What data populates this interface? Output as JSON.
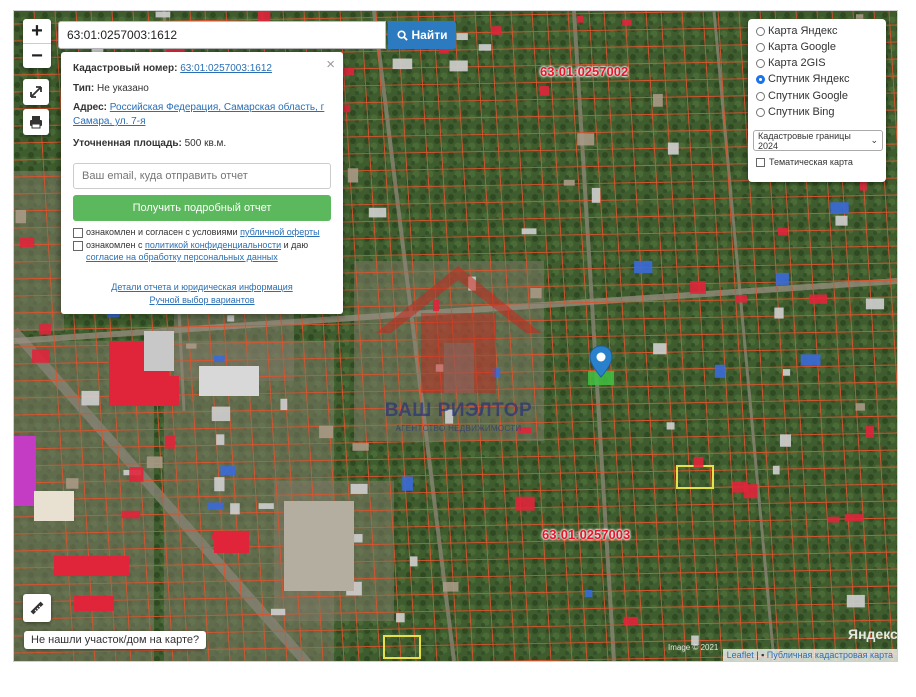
{
  "search": {
    "value": "63:01:0257003:1612",
    "button_label": "Найти"
  },
  "zoom": {
    "plus": "+",
    "minus": "−"
  },
  "popup": {
    "cadnum_label": "Кадастровый номер:",
    "cadnum_value": "63:01:0257003:1612",
    "type_label": "Тип:",
    "type_value": "Не указано",
    "address_label": "Адрес:",
    "address_value": "Российская Федерация, Самарская область, г Самара, ул. 7-я",
    "area_label": "Уточненная площадь:",
    "area_value": "500 кв.м.",
    "email_placeholder": "Ваш email, куда отправить отчет",
    "submit_label": "Получить подробный отчет",
    "consent1_prefix": "ознакомлен и согласен с условиями",
    "consent1_link": "публичной оферты",
    "consent2_prefix": "ознакомлен с",
    "consent2_link": "политикой конфиденциальности",
    "consent2_mid": "и даю",
    "consent2_link2": "согласие на обработку персональных данных",
    "details_link": "Детали отчета и юридическая информация",
    "manual_link": "Ручной выбор вариантов"
  },
  "layers": {
    "options": [
      {
        "label": "Карта Яндекс",
        "selected": false
      },
      {
        "label": "Карта Google",
        "selected": false
      },
      {
        "label": "Карта 2GIS",
        "selected": false
      },
      {
        "label": "Спутник Яндекс",
        "selected": true
      },
      {
        "label": "Спутник Google",
        "selected": false
      },
      {
        "label": "Спутник Bing",
        "selected": false
      }
    ],
    "select_value": "Кадастровые границы 2024",
    "thematic_label": "Тематическая карта"
  },
  "cadastral_labels": [
    "63:01:0257002",
    "63:01:0257003"
  ],
  "watermark": {
    "line1": "ВАШ РИЭЛТОР",
    "line2": "АГЕНТСТВО НЕДВИЖИМОСТИ"
  },
  "not_found_label": "Не нашли участок/дом на карте?",
  "map_copyright": "Image © 2021",
  "yandex_logo": "Яндекс",
  "attribution": {
    "leaflet": "Leaflet",
    "separator": "|",
    "rosreestr": "Публичная кадастровая карта"
  },
  "colors": {
    "accent": "#2c7bc0",
    "cta": "#5cb85c",
    "cadastral_line": "#d9542e",
    "label_red": "#e8152b"
  }
}
